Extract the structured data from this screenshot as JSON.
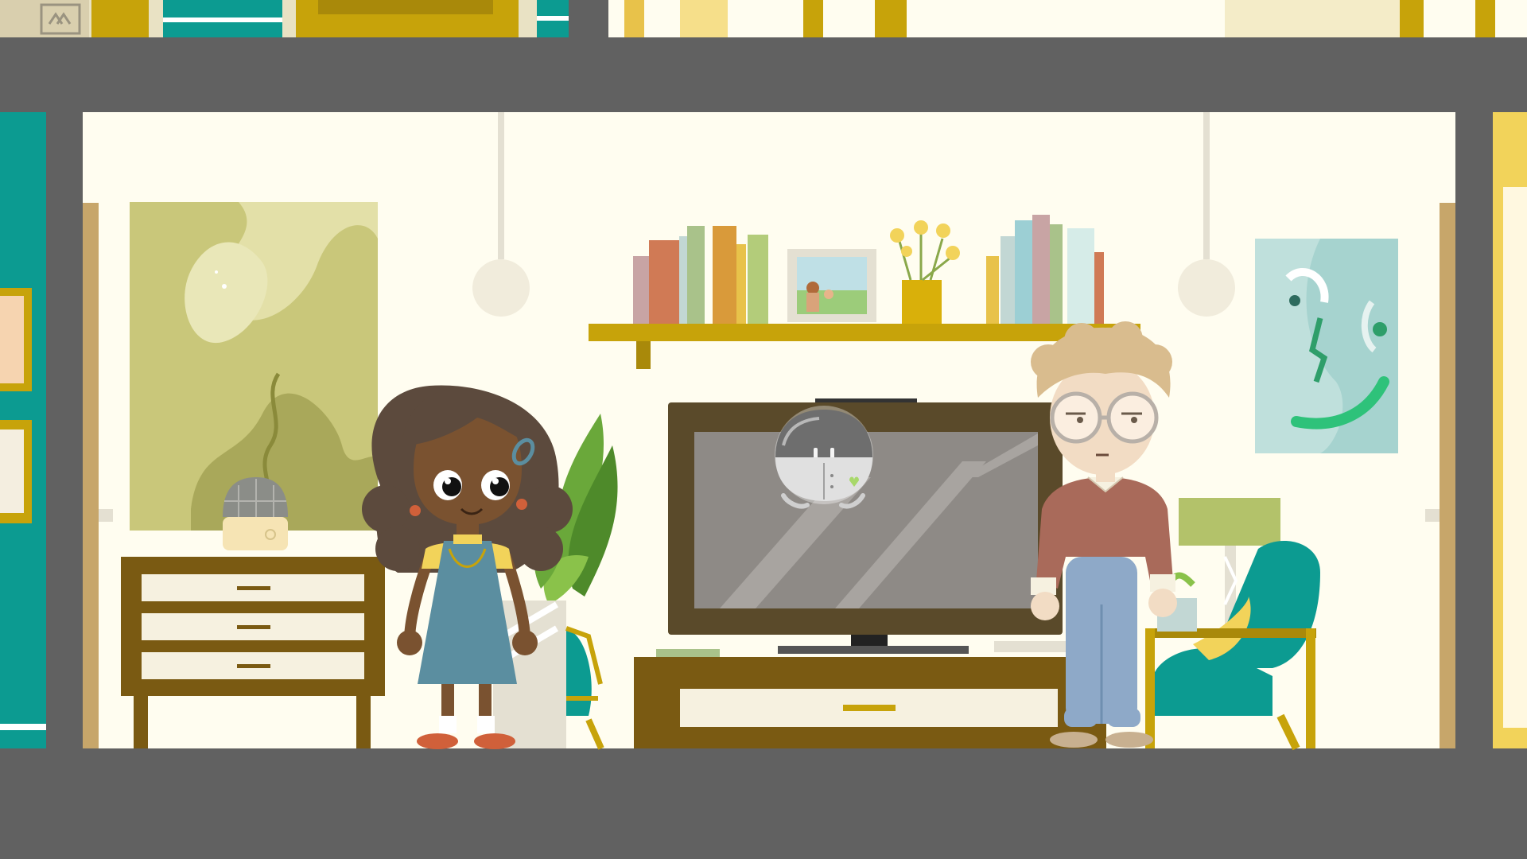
{
  "scene": {
    "type": "side-scrolling house cross-section",
    "current_room": "living room"
  },
  "characters": [
    {
      "name": "girl-character"
    },
    {
      "name": "robot-companion"
    },
    {
      "name": "boy-character"
    }
  ],
  "colors": {
    "wall": "#fffdf0",
    "floor_divider": "#616161",
    "teal": "#0c9b91",
    "mustard": "#c7a30a",
    "wood": "#7a5a12"
  }
}
